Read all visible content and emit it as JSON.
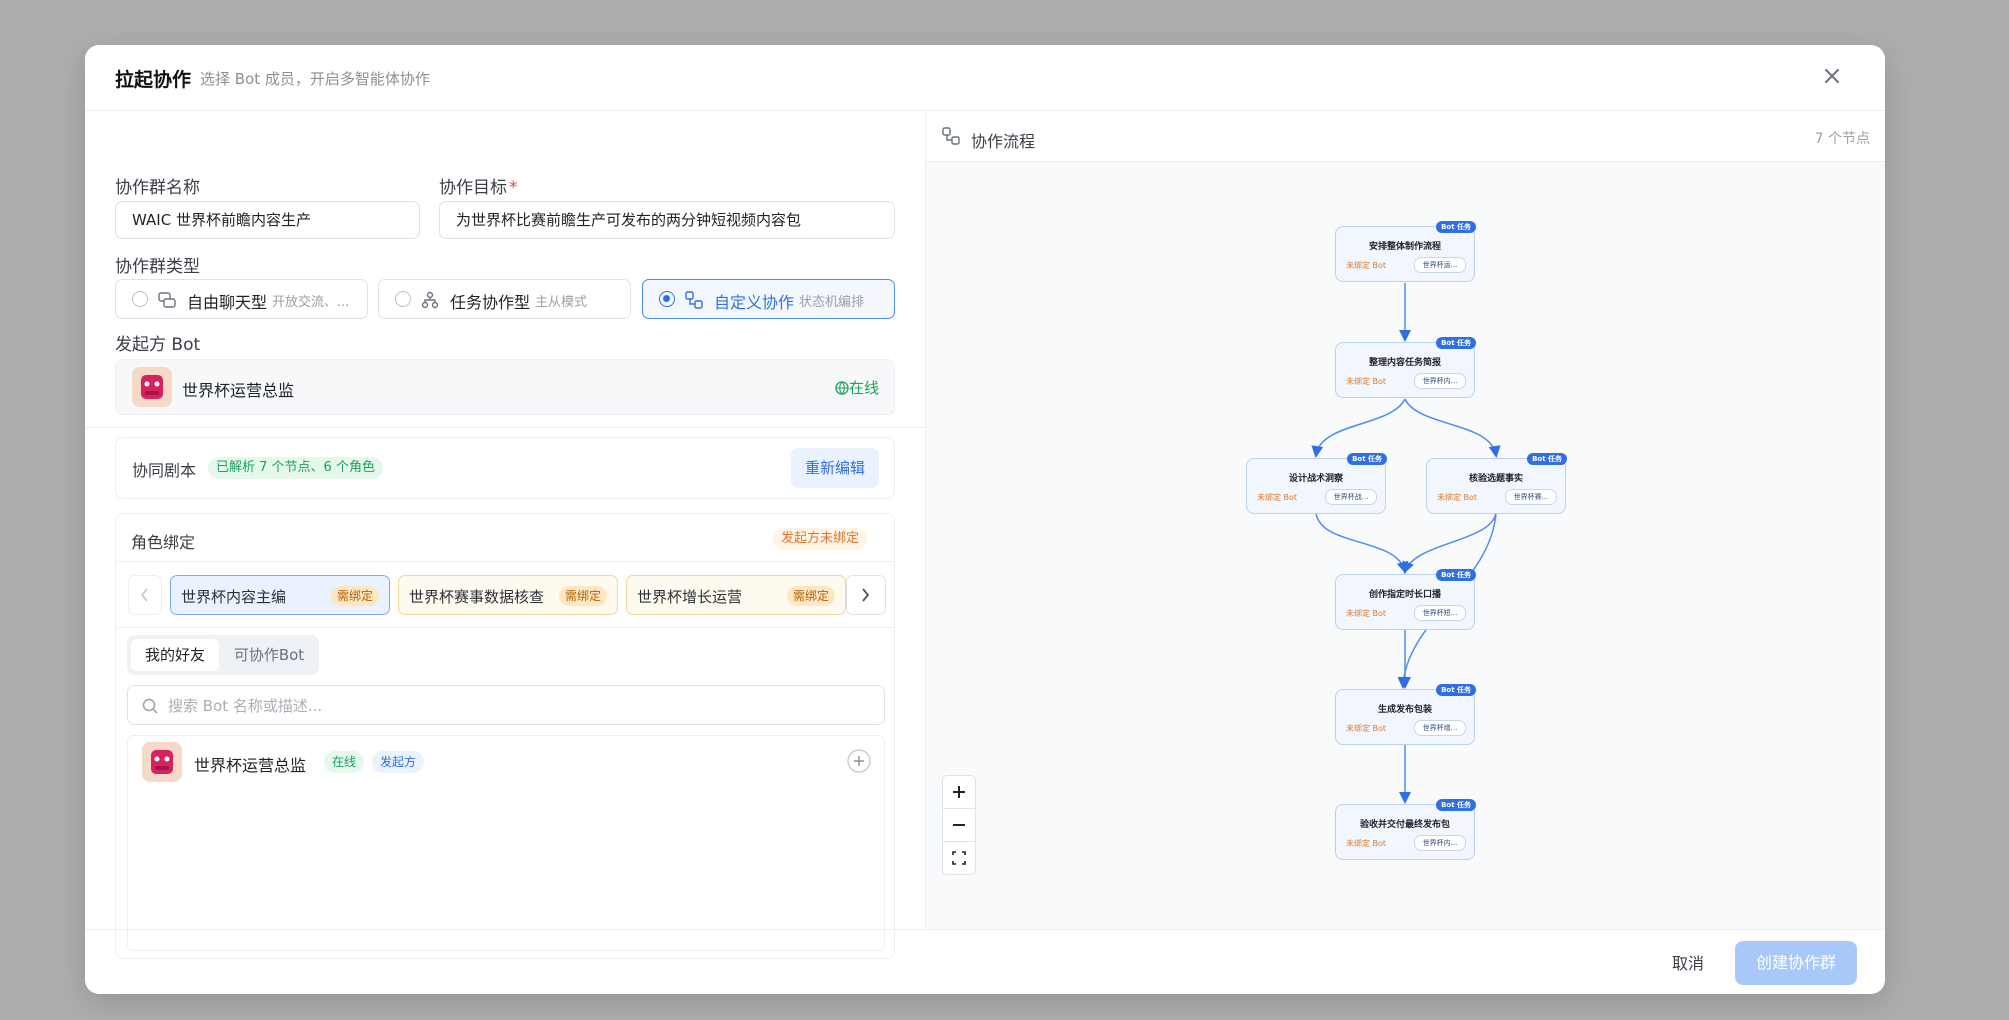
{
  "header": {
    "title": "拉起协作",
    "subtitle": "选择 Bot 成员，开启多智能体协作"
  },
  "form": {
    "group_name_label": "协作群名称",
    "group_name_value": "WAIC 世界杯前瞻内容生产",
    "goal_label": "协作目标",
    "goal_required": "*",
    "goal_value": "为世界杯比赛前瞻生产可发布的两分钟短视频内容包",
    "type_label": "协作群类型",
    "types": [
      {
        "name": "自由聊天型",
        "desc": "开放交流、...",
        "selected": false
      },
      {
        "name": "任务协作型",
        "desc": "主从模式",
        "selected": false
      },
      {
        "name": "自定义协作",
        "desc": "状态机编排",
        "selected": true
      }
    ],
    "initiator_label": "发起方 Bot",
    "initiator_name": "世界杯运营总监",
    "initiator_status": "在线"
  },
  "script": {
    "label": "协同剧本",
    "badge": "已解析 7 个节点、6 个角色",
    "reedit": "重新编辑"
  },
  "roles": {
    "label": "角色绑定",
    "warn": "发起方未绑定",
    "chips": [
      {
        "name": "世界杯内容主编",
        "badge": "需绑定"
      },
      {
        "name": "世界杯赛事数据核查",
        "badge": "需绑定"
      },
      {
        "name": "世界杯增长运营",
        "badge": "需绑定"
      }
    ],
    "tabs": [
      "我的好友",
      "可协作Bot"
    ],
    "search_placeholder": "搜索 Bot 名称或描述...",
    "bot": {
      "name": "世界杯运营总监",
      "status": "在线",
      "role": "发起方"
    }
  },
  "flow": {
    "title": "协作流程",
    "count": "7 个节点",
    "tag": "Bot 任务",
    "unbound": "未绑定 Bot",
    "nodes": [
      {
        "title": "安排整体制作流程",
        "bot": "世界杯运..."
      },
      {
        "title": "整理内容任务简报",
        "bot": "世界杯内..."
      },
      {
        "title": "设计战术洞察",
        "bot": "世界杯战..."
      },
      {
        "title": "核验选题事实",
        "bot": "世界杯赛..."
      },
      {
        "title": "创作指定时长口播",
        "bot": "世界杯短..."
      },
      {
        "title": "生成发布包装",
        "bot": "世界杯增..."
      },
      {
        "title": "验收并交付最终发布包",
        "bot": "世界杯内..."
      }
    ]
  },
  "footer": {
    "cancel": "取消",
    "create": "创建协作群"
  },
  "colors": {
    "accent": "#2f6fe4",
    "online": "#1aa35a",
    "warn": "#e0782a"
  }
}
